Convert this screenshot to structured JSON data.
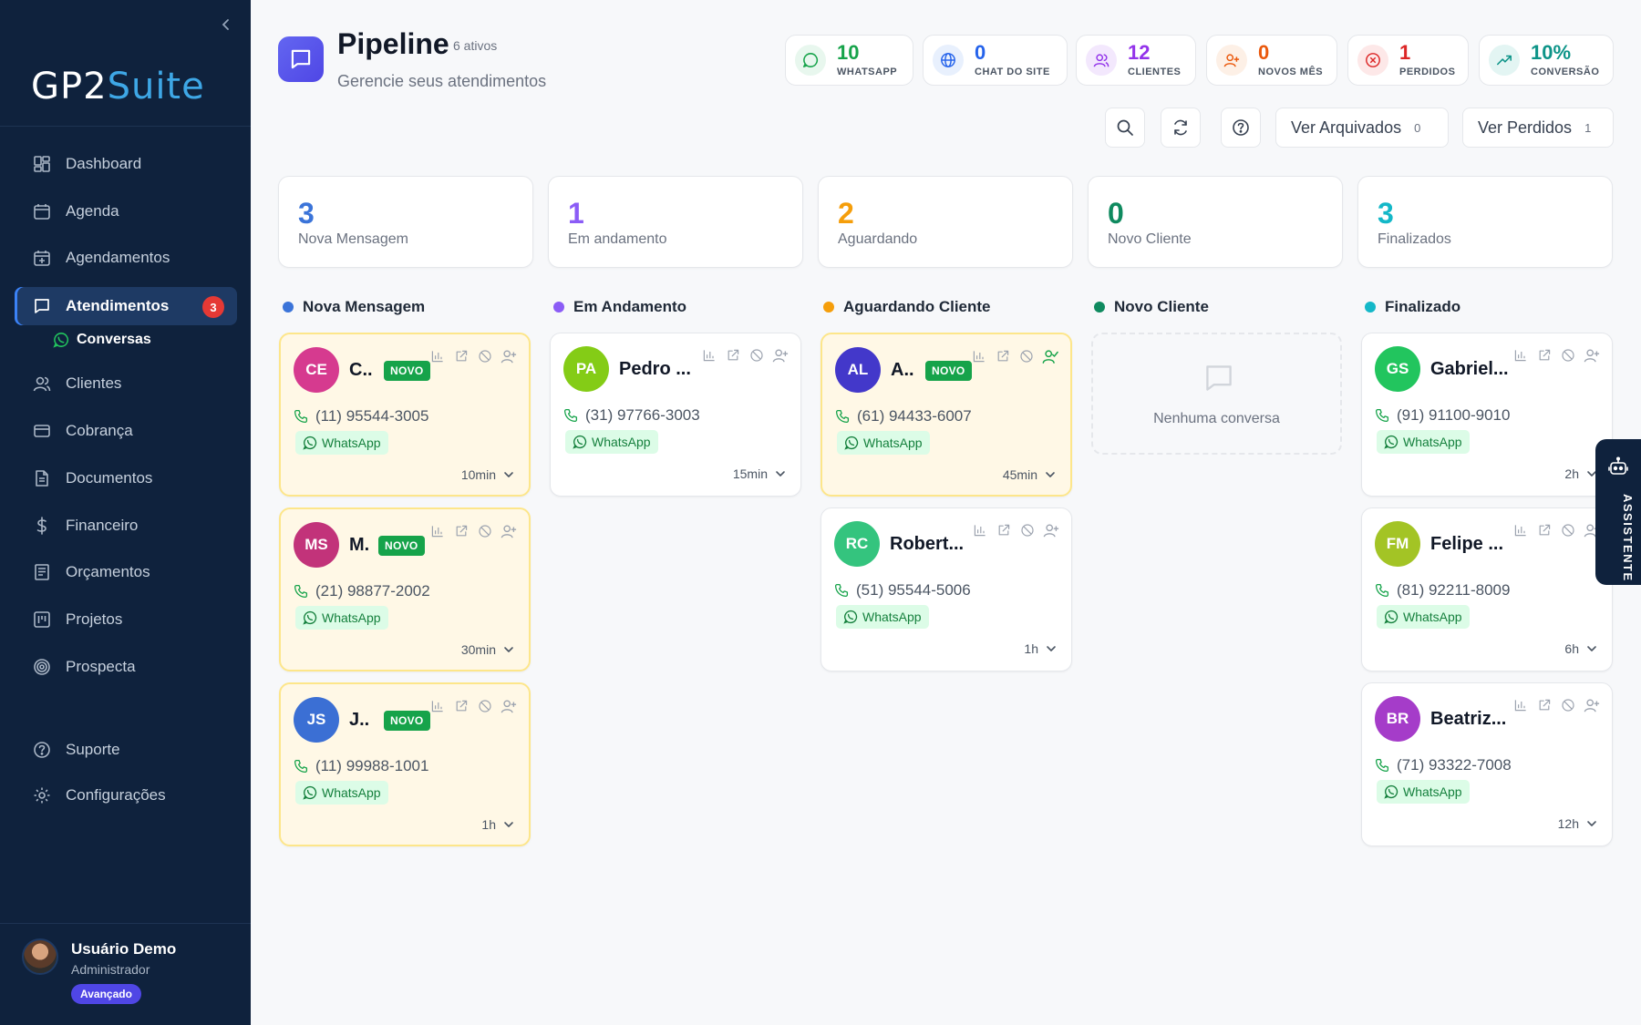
{
  "app": {
    "logo_a": "GP2",
    "logo_b": "Suite"
  },
  "sidebar": {
    "items": [
      {
        "label": "Dashboard",
        "icon": "dashboard-icon"
      },
      {
        "label": "Agenda",
        "icon": "calendar-icon"
      },
      {
        "label": "Agendamentos",
        "icon": "calendar-plus-icon"
      },
      {
        "label": "Atendimentos",
        "icon": "chat-icon",
        "badge": "3",
        "active": true
      },
      {
        "label": "Clientes",
        "icon": "users-icon"
      },
      {
        "label": "Cobrança",
        "icon": "credit-card-icon"
      },
      {
        "label": "Documentos",
        "icon": "document-icon"
      },
      {
        "label": "Financeiro",
        "icon": "dollar-icon"
      },
      {
        "label": "Orçamentos",
        "icon": "receipt-icon"
      },
      {
        "label": "Projetos",
        "icon": "kanban-icon"
      },
      {
        "label": "Prospecta",
        "icon": "target-icon"
      },
      {
        "label": "Suporte",
        "icon": "help-icon"
      },
      {
        "label": "Configurações",
        "icon": "gear-icon"
      }
    ],
    "sub_item": {
      "label": "Conversas",
      "icon": "whatsapp-icon"
    },
    "user": {
      "name": "Usuário Demo",
      "role": "Administrador",
      "plan": "Avançado"
    }
  },
  "header": {
    "title": "Pipeline",
    "count": "6 ativos",
    "subtitle": "Gerencie seus atendimentos"
  },
  "stats": [
    {
      "value": "10",
      "label": "WHATSAPP",
      "color": "#16a34a",
      "bg": "#e8f7ee",
      "icon": "chat-bubble-icon"
    },
    {
      "value": "0",
      "label": "CHAT DO SITE",
      "color": "#2563eb",
      "bg": "#e8f0fd",
      "icon": "globe-icon"
    },
    {
      "value": "12",
      "label": "CLIENTES",
      "color": "#9333ea",
      "bg": "#f3e8fd",
      "icon": "users-icon"
    },
    {
      "value": "0",
      "label": "NOVOS MÊS",
      "color": "#ea580c",
      "bg": "#fdf0e6",
      "icon": "user-plus-icon"
    },
    {
      "value": "1",
      "label": "PERDIDOS",
      "color": "#dc2626",
      "bg": "#fde8e8",
      "icon": "x-circle-icon"
    },
    {
      "value": "10%",
      "label": "CONVERSÃO",
      "color": "#0d9488",
      "bg": "#e3f5f3",
      "icon": "trending-up-icon"
    }
  ],
  "toolbar": {
    "archived_label": "Ver Arquivados",
    "archived_count": "0",
    "lost_label": "Ver Perdidos",
    "lost_count": "1"
  },
  "summary": [
    {
      "value": "3",
      "label": "Nova Mensagem",
      "color": "#3b74d9"
    },
    {
      "value": "1",
      "label": "Em andamento",
      "color": "#8b5cf6"
    },
    {
      "value": "2",
      "label": "Aguardando",
      "color": "#f59e0b"
    },
    {
      "value": "0",
      "label": "Novo Cliente",
      "color": "#0f8a5f"
    },
    {
      "value": "3",
      "label": "Finalizados",
      "color": "#14b8c8"
    }
  ],
  "columns": [
    {
      "title": "Nova Mensagem",
      "color": "#3b74d9",
      "cards": [
        {
          "initials": "CE",
          "name": "C..",
          "novo": "NOVO",
          "phone": "(11) 95544-3005",
          "channel": "WhatsApp",
          "time": "10min",
          "avatar_color": "#d63a8f",
          "highlight": true,
          "assigned": false
        },
        {
          "initials": "MS",
          "name": "M.",
          "novo": "NOVO",
          "phone": "(21) 98877-2002",
          "channel": "WhatsApp",
          "time": "30min",
          "avatar_color": "#c2337a",
          "highlight": true,
          "assigned": false
        },
        {
          "initials": "JS",
          "name": "J..",
          "novo": "NOVO",
          "phone": "(11) 99988-1001",
          "channel": "WhatsApp",
          "time": "1h",
          "avatar_color": "#3b6fd4",
          "highlight": true,
          "assigned": false
        }
      ]
    },
    {
      "title": "Em Andamento",
      "color": "#8b5cf6",
      "cards": [
        {
          "initials": "PA",
          "name": "Pedro ...",
          "novo": "",
          "phone": "(31) 97766-3003",
          "channel": "WhatsApp",
          "time": "15min",
          "avatar_color": "#84cc16",
          "highlight": false,
          "assigned": false
        }
      ]
    },
    {
      "title": "Aguardando Cliente",
      "color": "#f59e0b",
      "cards": [
        {
          "initials": "AL",
          "name": "A..",
          "novo": "NOVO",
          "phone": "(61) 94433-6007",
          "channel": "WhatsApp",
          "time": "45min",
          "avatar_color": "#4338ca",
          "highlight": true,
          "assigned": true
        },
        {
          "initials": "RC",
          "name": "Robert...",
          "novo": "",
          "phone": "(51) 95544-5006",
          "channel": "WhatsApp",
          "time": "1h",
          "avatar_color": "#34c47e",
          "highlight": false,
          "assigned": false
        }
      ]
    },
    {
      "title": "Novo Cliente",
      "color": "#0f8a5f",
      "cards": [],
      "empty_text": "Nenhuma conversa"
    },
    {
      "title": "Finalizado",
      "color": "#14b8c8",
      "cards": [
        {
          "initials": "GS",
          "name": "Gabriel...",
          "novo": "",
          "phone": "(91) 91100-9010",
          "channel": "WhatsApp",
          "time": "2h",
          "avatar_color": "#22c55e",
          "highlight": false,
          "assigned": false
        },
        {
          "initials": "FM",
          "name": "Felipe ...",
          "novo": "",
          "phone": "(81) 92211-8009",
          "channel": "WhatsApp",
          "time": "6h",
          "avatar_color": "#a3c425",
          "highlight": false,
          "assigned": false
        },
        {
          "initials": "BR",
          "name": "Beatriz...",
          "novo": "",
          "phone": "(71) 93322-7008",
          "channel": "WhatsApp",
          "time": "12h",
          "avatar_color": "#a53cc9",
          "highlight": false,
          "assigned": false
        }
      ]
    }
  ],
  "assistant": {
    "label": "ASSISTENTE",
    "icon": "robot-icon"
  }
}
